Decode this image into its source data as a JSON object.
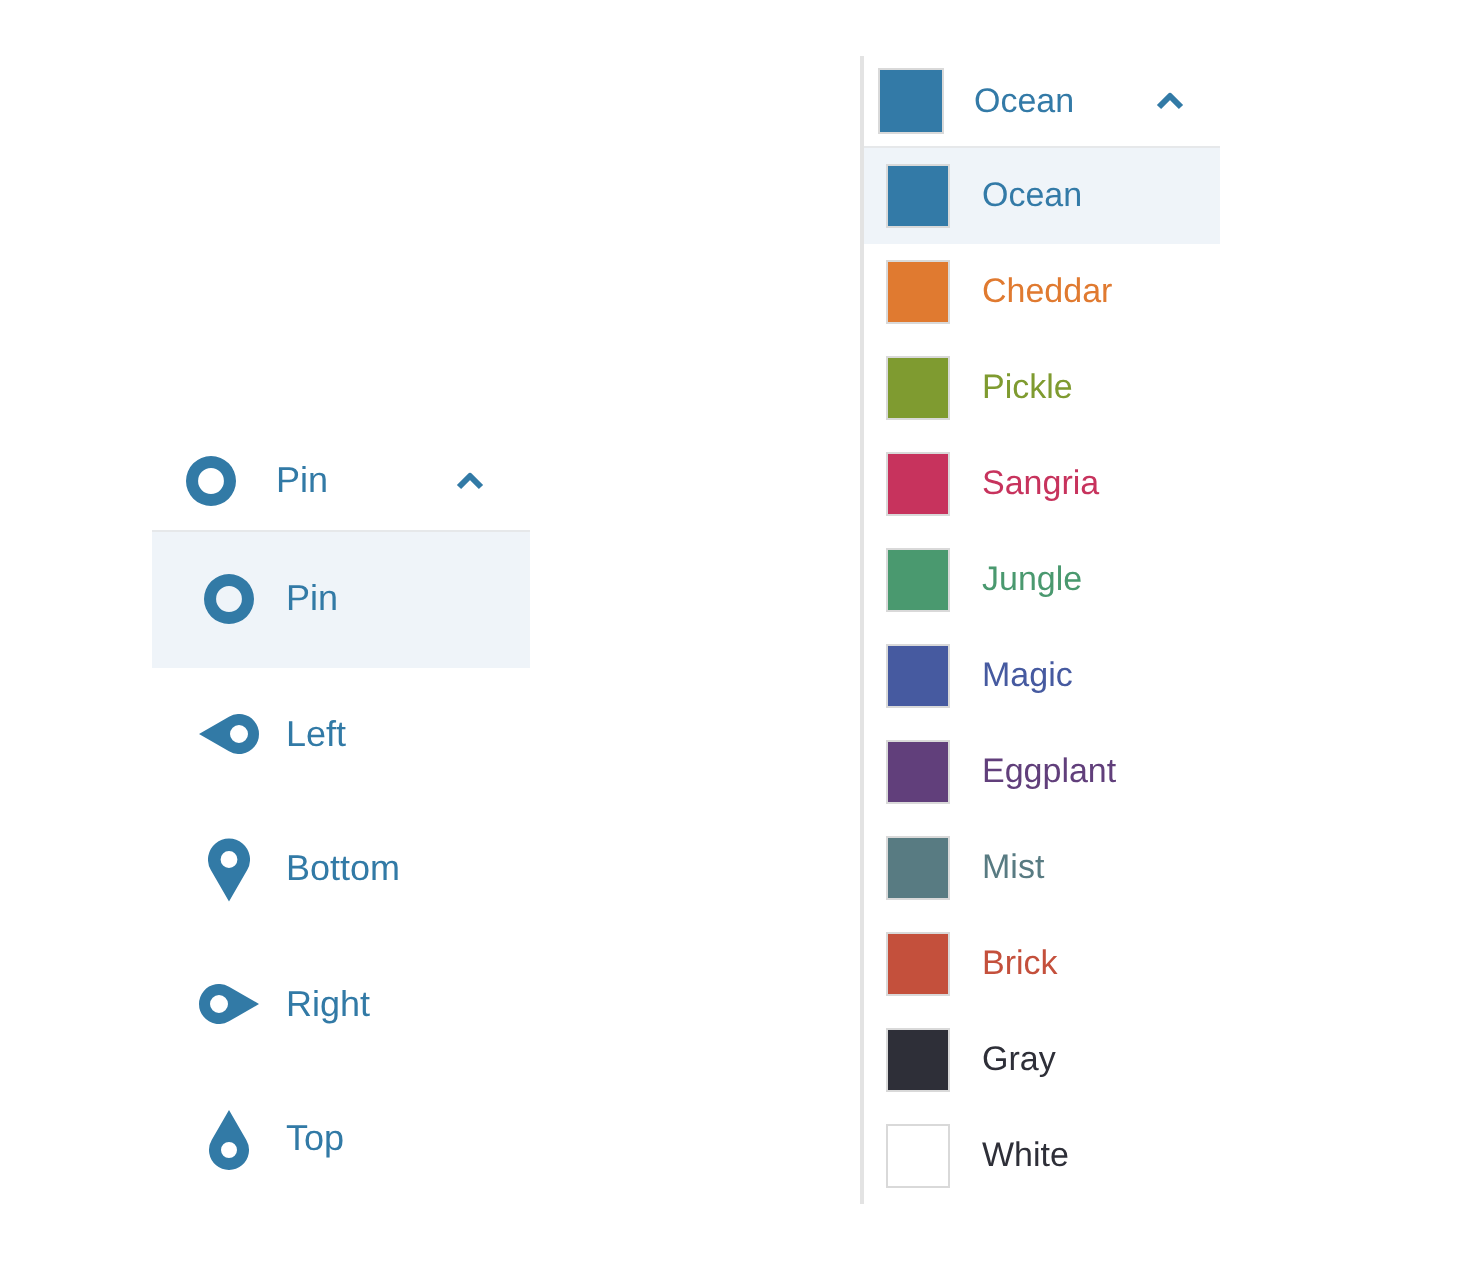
{
  "pin_dropdown": {
    "value": {
      "label": "Pin",
      "kind": "pin"
    },
    "expanded": true,
    "options": [
      {
        "label": "Pin",
        "kind": "pin",
        "selected": true
      },
      {
        "label": "Left",
        "kind": "left",
        "selected": false
      },
      {
        "label": "Bottom",
        "kind": "bottom",
        "selected": false
      },
      {
        "label": "Right",
        "kind": "right",
        "selected": false
      },
      {
        "label": "Top",
        "kind": "top",
        "selected": false
      }
    ]
  },
  "color_dropdown": {
    "value": {
      "label": "Ocean",
      "color": "#337aa7"
    },
    "expanded": true,
    "options": [
      {
        "label": "Ocean",
        "color": "#337aa7",
        "selected": true
      },
      {
        "label": "Cheddar",
        "color": "#e07a30",
        "selected": false
      },
      {
        "label": "Pickle",
        "color": "#7f9b30",
        "selected": false
      },
      {
        "label": "Sangria",
        "color": "#c7335d",
        "selected": false
      },
      {
        "label": "Jungle",
        "color": "#4a996f",
        "selected": false
      },
      {
        "label": "Magic",
        "color": "#465aa0",
        "selected": false
      },
      {
        "label": "Eggplant",
        "color": "#613f7b",
        "selected": false
      },
      {
        "label": "Mist",
        "color": "#587b82",
        "selected": false
      },
      {
        "label": "Brick",
        "color": "#c4503c",
        "selected": false
      },
      {
        "label": "Gray",
        "color": "#2e2f38",
        "selected": false
      },
      {
        "label": "White",
        "color": "#ffffff",
        "selected": false
      }
    ]
  }
}
